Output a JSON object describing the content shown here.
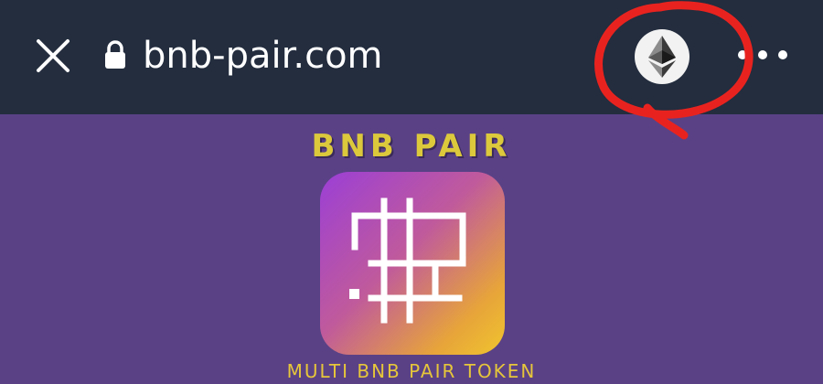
{
  "browser": {
    "url": "bnb-pair.com",
    "icons": {
      "close": "close-icon",
      "lock": "lock-icon",
      "wallet": "ethereum-icon",
      "menu": "more-options-icon"
    }
  },
  "page": {
    "brand_title": "BNB PAIR",
    "tagline": "MULTI BNB PAIR TOKEN",
    "logo_icon": "bnb-pair-logo-icon"
  },
  "colors": {
    "toolbar_bg": "#232d3e",
    "page_bg": "#5a4186",
    "brand_yellow": "#dcc93c",
    "annotation_red": "#e8231f"
  }
}
